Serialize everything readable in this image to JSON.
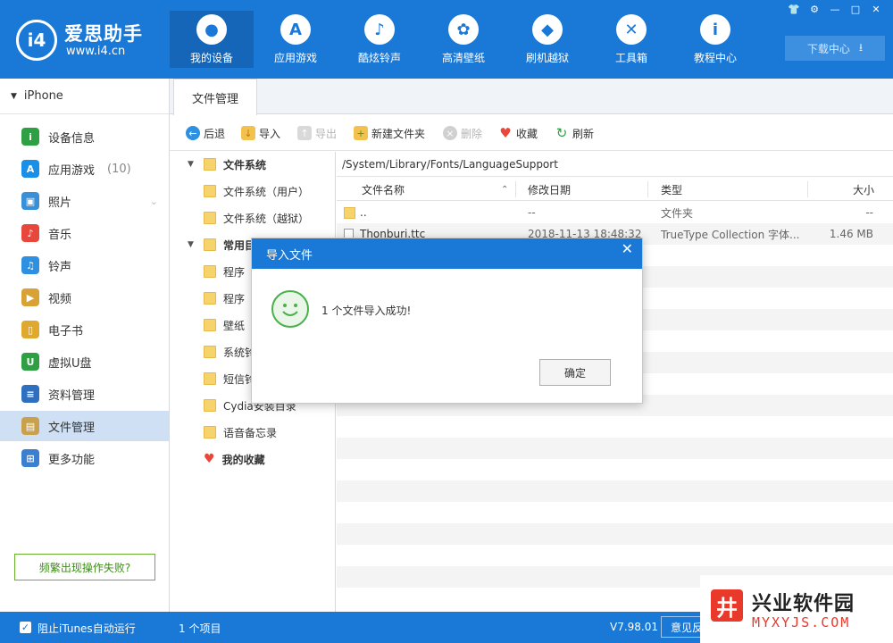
{
  "brand": {
    "name": "爱思助手",
    "url": "www.i4.cn",
    "mark": "i4"
  },
  "nav": [
    {
      "label": "我的设备",
      "icon": "apple-icon",
      "glyph": ""
    },
    {
      "label": "应用游戏",
      "icon": "app-store-icon",
      "glyph": "A"
    },
    {
      "label": "酷炫铃声",
      "icon": "bell-icon",
      "glyph": "♪"
    },
    {
      "label": "高清壁纸",
      "icon": "flower-icon",
      "glyph": "✿"
    },
    {
      "label": "刷机越狱",
      "icon": "box-icon",
      "glyph": "◆"
    },
    {
      "label": "工具箱",
      "icon": "tools-icon",
      "glyph": "✕"
    },
    {
      "label": "教程中心",
      "icon": "info-icon",
      "glyph": "i"
    }
  ],
  "window_controls": [
    "👕",
    "⚙",
    "—",
    "□",
    "✕"
  ],
  "download_center": "下载中心",
  "device": "iPhone",
  "sidebar": [
    {
      "label": "设备信息",
      "icon": "info-icon",
      "color": "#2ea043",
      "glyph": "i"
    },
    {
      "label": "应用游戏",
      "count": "(10)",
      "icon": "app-store-icon",
      "color": "#1a8fe8",
      "glyph": "A"
    },
    {
      "label": "照片",
      "icon": "photo-icon",
      "color": "#3a8fd9",
      "glyph": "▣"
    },
    {
      "label": "音乐",
      "icon": "music-icon",
      "color": "#e8483b",
      "glyph": "♪"
    },
    {
      "label": "铃声",
      "icon": "bell-icon",
      "color": "#2f8fe0",
      "glyph": "♫"
    },
    {
      "label": "视频",
      "icon": "video-icon",
      "color": "#d8a235",
      "glyph": "▶"
    },
    {
      "label": "电子书",
      "icon": "book-icon",
      "color": "#e0a92e",
      "glyph": "▯"
    },
    {
      "label": "虚拟U盘",
      "icon": "usb-icon",
      "color": "#2ea043",
      "glyph": "U"
    },
    {
      "label": "资料管理",
      "icon": "contacts-icon",
      "color": "#2f6fbf",
      "glyph": "≡"
    },
    {
      "label": "文件管理",
      "icon": "files-icon",
      "color": "#c9a14c",
      "glyph": "▤"
    },
    {
      "label": "更多功能",
      "icon": "grid-icon",
      "color": "#3b7fd0",
      "glyph": "⊞"
    }
  ],
  "help_button": "频繁出现操作失败?",
  "tab": "文件管理",
  "toolbar": {
    "back": "后退",
    "import": "导入",
    "export": "导出",
    "new_folder": "新建文件夹",
    "delete": "删除",
    "favorite": "收藏",
    "refresh": "刷新"
  },
  "tree": [
    {
      "label": "文件系统",
      "level": 0,
      "bold": true,
      "caret": "▼"
    },
    {
      "label": "文件系统（用户）",
      "level": 1
    },
    {
      "label": "文件系统（越狱）",
      "level": 1
    },
    {
      "label": "常用目",
      "level": 0,
      "bold": true,
      "caret": "▼"
    },
    {
      "label": "程序",
      "level": 1
    },
    {
      "label": "程序",
      "level": 1
    },
    {
      "label": "壁纸",
      "level": 1
    },
    {
      "label": "系统铃",
      "level": 1
    },
    {
      "label": "短信铃",
      "level": 1
    },
    {
      "label": "Cydia安装目录",
      "level": 1
    },
    {
      "label": "语音备忘录",
      "level": 1
    },
    {
      "label": "我的收藏",
      "level": 0,
      "bold": true,
      "heart": true
    }
  ],
  "path": "/System/Library/Fonts/LanguageSupport",
  "columns": {
    "name": "文件名称",
    "date": "修改日期",
    "type": "类型",
    "size": "大小"
  },
  "files": [
    {
      "name": "..",
      "date": "--",
      "type": "文件夹",
      "size": "--"
    },
    {
      "name": "Thonburi.ttc",
      "date": "2018-11-13 18:48:32",
      "type": "TrueType Collection 字体...",
      "size": "1.46 MB"
    }
  ],
  "dialog": {
    "title": "导入文件",
    "message": "1 个文件导入成功!",
    "ok": "确定"
  },
  "status": {
    "itunes_block": "阻止iTunes自动运行",
    "item_count": "1 个项目",
    "version": "V7.98.01",
    "feedback": "意见反"
  },
  "watermark": {
    "title": "兴业软件园",
    "sub": "MYXYJS.COM"
  }
}
